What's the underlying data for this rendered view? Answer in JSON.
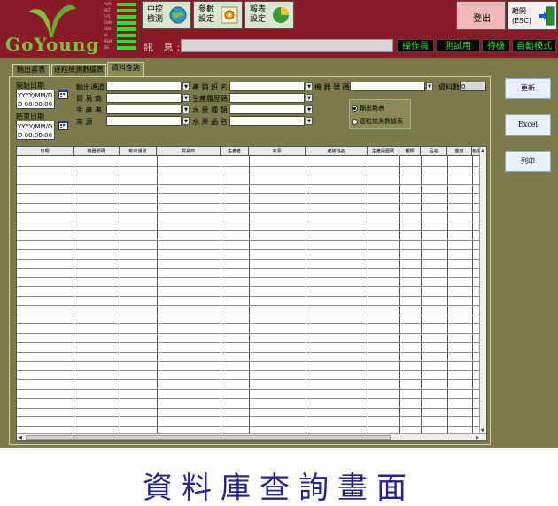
{
  "brand": {
    "logo_text": "GoYoung"
  },
  "meter": {
    "labels": [
      "PWR",
      "NET",
      "SYS",
      "CAM",
      "SEN",
      "IO",
      "MEM",
      "DB"
    ]
  },
  "toolbar": {
    "central_label": "中控\n檢測",
    "params_label": "參數\n設定",
    "report_label": "報表\n設定",
    "logout_label": "登出",
    "exit_label": "離開\n(ESC)"
  },
  "message": {
    "label": "訊 息:",
    "value": ""
  },
  "status": {
    "operator": "操作員",
    "test": "測試用",
    "standby": "待機",
    "mode": "自動模式"
  },
  "tabs": [
    "輸出畫表",
    "逐粒檢測數據表",
    "資料查詢"
  ],
  "filters": {
    "start_date_label": "開始日期",
    "start_date_value": "YYYY/MM/DD 00:00:00",
    "end_date_label": "結束日期",
    "end_date_value": "YYYY/MM/DD 00:00:00",
    "output_channel_label": "輸出通道",
    "trader_label": "貿 易 商",
    "producer_label": "生 產 者",
    "source_label": "來    源",
    "farmer_label": "產 銷 班 名",
    "history_label": "生產履歷碼",
    "fruit_type_label": "水 果 種 類",
    "fruit_name_label": "水 果 品 名",
    "machine_label": "機 器 號 碼",
    "count_label": "資料數",
    "count_value": "0"
  },
  "radio": {
    "option1": "輸出報表",
    "option2": "逐粒檢測數據表",
    "selected": 1
  },
  "buttons": {
    "refresh": "更新",
    "excel": "Excel",
    "print": "列印"
  },
  "table": {
    "columns": [
      "日期",
      "機器號碼",
      "輸出通道",
      "貿易商",
      "生產者",
      "來源",
      "產銷班名",
      "生產履歷碼",
      "種類",
      "品名",
      "重度",
      "色度"
    ]
  },
  "caption": "資料庫查詢畫面"
}
